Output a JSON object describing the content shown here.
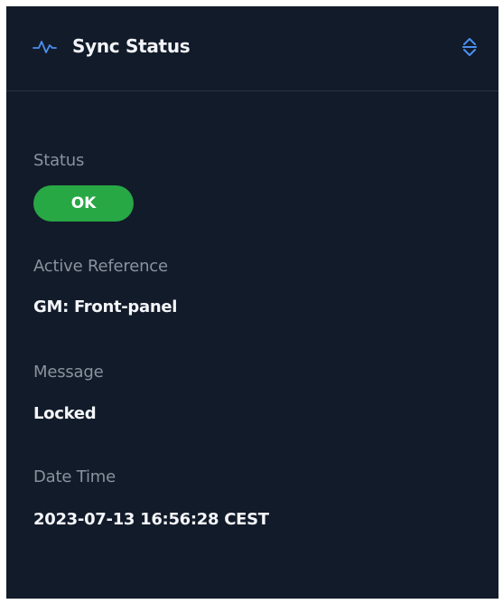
{
  "panel": {
    "title": "Sync Status",
    "header_icon": "pulse-icon",
    "collapse_icon": "sort-icon"
  },
  "fields": {
    "status": {
      "label": "Status",
      "value": "OK",
      "color": "#28a745"
    },
    "active_reference": {
      "label": "Active Reference",
      "value": "GM: Front-panel"
    },
    "message": {
      "label": "Message",
      "value": "Locked"
    },
    "date_time": {
      "label": "Date Time",
      "value": "2023-07-13 16:56:28 CEST"
    }
  },
  "colors": {
    "background": "#121b2a",
    "accent": "#4a90f0",
    "ok": "#28a745",
    "label": "#8a929e",
    "value": "#f4f6f9"
  }
}
